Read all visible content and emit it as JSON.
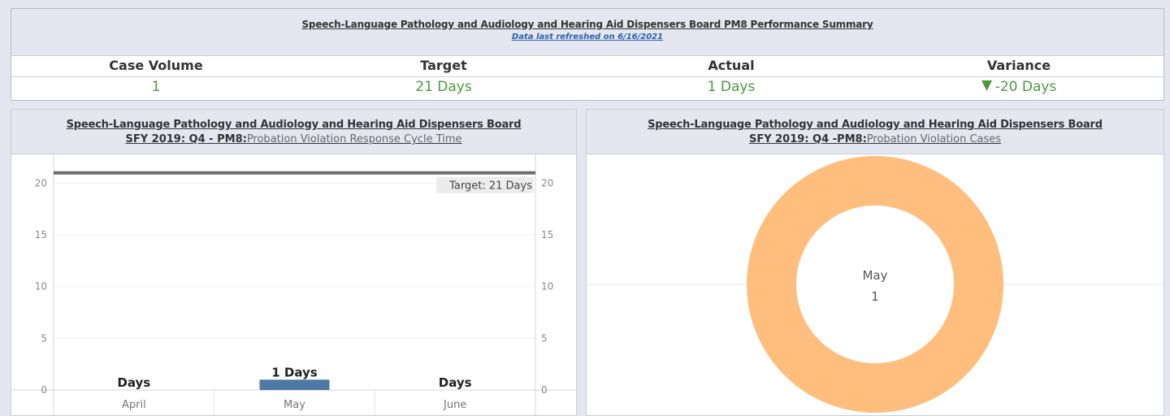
{
  "summary": {
    "title": "Speech-Language Pathology and Audiology and Hearing Aid Dispensers Board PM8 Performance Summary",
    "refreshed": "Data last refreshed on 6/16/2021",
    "headers": [
      "Case Volume",
      "Target",
      "Actual",
      "Variance"
    ],
    "values": [
      "1",
      "21 Days",
      "1 Days",
      "-20 Days"
    ],
    "variance_icon": "triangle-down-icon",
    "value_color": "#4b9a3e"
  },
  "left_panel": {
    "title": "Speech-Language Pathology and Audiology and Hearing Aid Dispensers Board",
    "subtitle_bold": "SFY 2019: Q4 -  PM8:",
    "subtitle_rest": "Probation Violation Response Cycle Time"
  },
  "right_panel": {
    "title": "Speech-Language Pathology and Audiology and Hearing Aid Dispensers Board",
    "subtitle_bold": "SFY 2019: Q4 -PM8:",
    "subtitle_rest": "Probation Violation Cases"
  },
  "chart_data": [
    {
      "type": "bar",
      "categories": [
        "April",
        "May",
        "June"
      ],
      "values": [
        0,
        1,
        0
      ],
      "bar_labels": [
        "Days",
        "1 Days",
        "Days"
      ],
      "ylim": [
        0,
        22
      ],
      "yticks": [
        0,
        5,
        10,
        15,
        20
      ],
      "dual_axis": true,
      "reference_line": {
        "value": 21,
        "label": "Target: 21 Days"
      },
      "bar_color": "#4e79a7",
      "xlabel": "",
      "ylabel": ""
    },
    {
      "type": "pie",
      "donut": true,
      "categories": [
        "May"
      ],
      "values": [
        1
      ],
      "center_label": "May",
      "center_value": "1",
      "color": "#ffbe7d"
    }
  ]
}
